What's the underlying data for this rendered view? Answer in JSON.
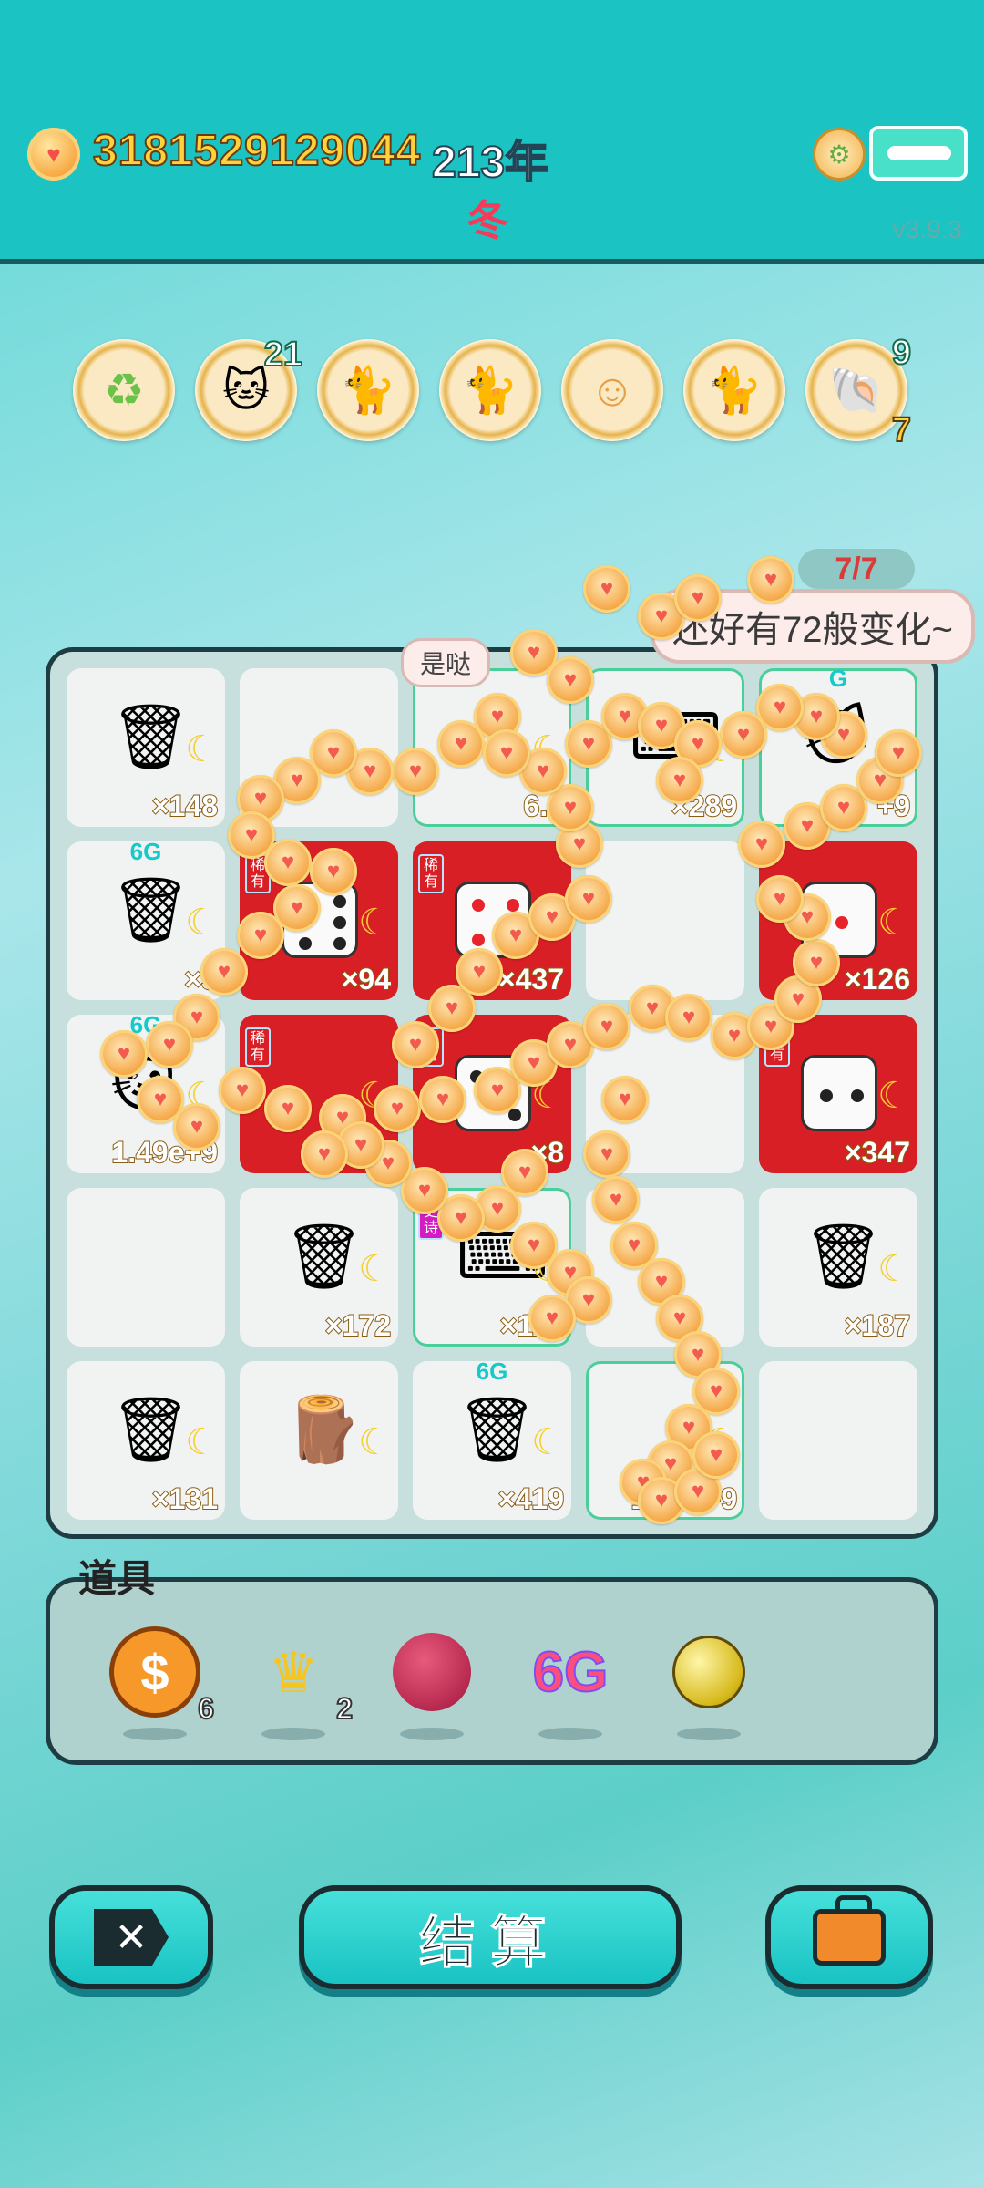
{
  "header": {
    "coins": "3181529129044",
    "year": "213年",
    "season": "冬",
    "version": "v3.9.3"
  },
  "relics": [
    {
      "name": "recycle-relic-icon",
      "count": ""
    },
    {
      "name": "cat-relic-icon",
      "count": "21"
    },
    {
      "name": "twin-cats-relic-icon",
      "count": ""
    },
    {
      "name": "twin-cats-relic-icon",
      "count": ""
    },
    {
      "name": "mooncake-relic-icon",
      "count": ""
    },
    {
      "name": "twin-cats-relic-icon",
      "count": ""
    },
    {
      "name": "shell-relic-icon",
      "count": "9",
      "count2": "7"
    }
  ],
  "bubble": {
    "text": "还好有72般变化~",
    "counter": "7/7",
    "small": "是哒"
  },
  "board": {
    "cells": [
      {
        "icon": "🗑",
        "qty": "×148"
      },
      {
        "icon": "",
        "qty": ""
      },
      {
        "icon": "",
        "qty": "6.9",
        "green": true
      },
      {
        "icon": "⌨",
        "qty": "×289",
        "green": true
      },
      {
        "icon": "🐱",
        "qty": "+9",
        "green": true,
        "badge": "G"
      },
      {
        "icon": "🗑",
        "qty": "×3",
        "badge": "6G"
      },
      {
        "icon": "dice6",
        "qty": "×94",
        "red": true,
        "tag": "稀有"
      },
      {
        "icon": "dice4",
        "qty": "×437",
        "red": true,
        "tag": "稀有"
      },
      {
        "icon": "",
        "qty": ""
      },
      {
        "icon": "dice1",
        "qty": "×126",
        "red": true
      },
      {
        "icon": "🐱",
        "qty": "1.49e+9",
        "badge": "6G"
      },
      {
        "icon": "",
        "qty": "×298",
        "red": true,
        "tag": "稀有"
      },
      {
        "icon": "dice3",
        "qty": "×8",
        "red": true,
        "tag": "稀有"
      },
      {
        "icon": "",
        "qty": ""
      },
      {
        "icon": "dice2",
        "qty": "×347",
        "red": true,
        "tag": "稀有"
      },
      {
        "icon": "",
        "qty": ""
      },
      {
        "icon": "🗑",
        "qty": "×172"
      },
      {
        "icon": "⌨",
        "qty": "×114",
        "green": true,
        "tag": "史诗"
      },
      {
        "icon": "",
        "qty": ""
      },
      {
        "icon": "🗑",
        "qty": "×187"
      },
      {
        "icon": "🗑",
        "qty": "×131"
      },
      {
        "icon": "🪵",
        "qty": ""
      },
      {
        "icon": "🗑",
        "qty": "×419",
        "badge": "6G"
      },
      {
        "icon": "",
        "qty": "1.59e+9",
        "green": true
      },
      {
        "icon": "",
        "qty": ""
      }
    ]
  },
  "items": {
    "title": "道具",
    "list": [
      {
        "name": "dollar-coin",
        "label": "$",
        "count": "6"
      },
      {
        "name": "crown",
        "label": "♛",
        "count": "2"
      },
      {
        "name": "lychee",
        "label": "",
        "count": ""
      },
      {
        "name": "six-g",
        "label": "6G",
        "count": ""
      },
      {
        "name": "gold-ball",
        "label": "",
        "count": ""
      }
    ]
  },
  "buttons": {
    "settle": "结算",
    "close_symbol": "✕"
  }
}
